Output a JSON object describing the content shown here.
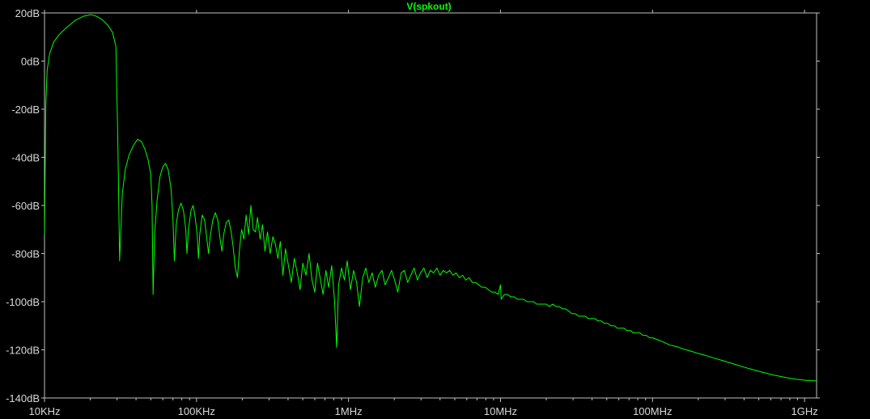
{
  "chart_data": {
    "type": "line",
    "title": "",
    "xlabel": "",
    "ylabel": "",
    "x_scale": "log",
    "xlim": [
      10000,
      1200000000
    ],
    "ylim": [
      -140,
      20
    ],
    "grid": false,
    "background": "#000000",
    "frame_color": "#c0c0c0",
    "x_tick_labels": [
      {
        "value": 10000,
        "label": "10KHz"
      },
      {
        "value": 100000,
        "label": "100KHz"
      },
      {
        "value": 1000000,
        "label": "1MHz"
      },
      {
        "value": 10000000,
        "label": "10MHz"
      },
      {
        "value": 100000000,
        "label": "100MHz"
      },
      {
        "value": 1000000000,
        "label": "1GHz"
      }
    ],
    "y_tick_labels": [
      {
        "value": 20,
        "label": "20dB"
      },
      {
        "value": 0,
        "label": "0dB"
      },
      {
        "value": -20,
        "label": "-20dB"
      },
      {
        "value": -40,
        "label": "-40dB"
      },
      {
        "value": -60,
        "label": "-60dB"
      },
      {
        "value": -80,
        "label": "-80dB"
      },
      {
        "value": -100,
        "label": "-100dB"
      },
      {
        "value": -120,
        "label": "-120dB"
      },
      {
        "value": -140,
        "label": "-140dB"
      }
    ],
    "series": [
      {
        "name": "V(spkout)",
        "color": "#00ff00",
        "x_unit": "Hz",
        "y_unit": "dB",
        "points": [
          [
            10000,
            -72
          ],
          [
            10080,
            -50
          ],
          [
            10200,
            -18
          ],
          [
            10400,
            -4
          ],
          [
            10800,
            3
          ],
          [
            11500,
            8
          ],
          [
            12500,
            11
          ],
          [
            14000,
            14
          ],
          [
            16000,
            17
          ],
          [
            18000,
            18.6
          ],
          [
            20200,
            19.3
          ],
          [
            22000,
            18.6
          ],
          [
            24000,
            17.2
          ],
          [
            26000,
            15
          ],
          [
            28000,
            12
          ],
          [
            29500,
            6
          ],
          [
            30300,
            -30
          ],
          [
            31200,
            -83
          ],
          [
            32500,
            -55
          ],
          [
            34000,
            -45
          ],
          [
            36000,
            -39
          ],
          [
            38500,
            -35
          ],
          [
            41000,
            -32.5
          ],
          [
            43500,
            -33.5
          ],
          [
            46000,
            -37
          ],
          [
            48000,
            -41
          ],
          [
            50000,
            -47
          ],
          [
            51000,
            -60
          ],
          [
            51800,
            -97
          ],
          [
            53000,
            -72
          ],
          [
            55000,
            -58
          ],
          [
            57500,
            -48
          ],
          [
            60000,
            -44
          ],
          [
            62500,
            -42.5
          ],
          [
            65000,
            -45
          ],
          [
            68000,
            -53
          ],
          [
            70000,
            -66
          ],
          [
            71500,
            -83
          ],
          [
            73500,
            -68
          ],
          [
            76000,
            -62
          ],
          [
            79000,
            -59
          ],
          [
            82000,
            -62
          ],
          [
            85000,
            -70
          ],
          [
            86500,
            -80
          ],
          [
            88500,
            -70
          ],
          [
            92000,
            -62
          ],
          [
            95000,
            -60
          ],
          [
            98000,
            -65
          ],
          [
            101000,
            -72
          ],
          [
            103000,
            -82
          ],
          [
            105000,
            -72
          ],
          [
            109000,
            -64
          ],
          [
            113000,
            -66
          ],
          [
            117000,
            -74
          ],
          [
            120000,
            -80
          ],
          [
            123000,
            -73
          ],
          [
            128000,
            -66
          ],
          [
            133000,
            -63
          ],
          [
            138000,
            -66
          ],
          [
            143000,
            -74
          ],
          [
            147000,
            -79
          ],
          [
            151000,
            -72
          ],
          [
            157000,
            -67
          ],
          [
            163000,
            -66
          ],
          [
            169000,
            -71
          ],
          [
            174000,
            -77
          ],
          [
            180000,
            -86
          ],
          [
            186000,
            -90
          ],
          [
            192000,
            -78
          ],
          [
            198000,
            -70
          ],
          [
            205000,
            -74
          ],
          [
            212000,
            -64
          ],
          [
            220000,
            -72
          ],
          [
            228000,
            -60
          ],
          [
            236000,
            -70
          ],
          [
            244000,
            -71
          ],
          [
            252000,
            -65
          ],
          [
            262000,
            -74
          ],
          [
            272000,
            -68
          ],
          [
            282000,
            -79
          ],
          [
            293000,
            -71
          ],
          [
            305000,
            -80
          ],
          [
            318000,
            -73
          ],
          [
            330000,
            -76
          ],
          [
            343000,
            -82
          ],
          [
            356000,
            -75
          ],
          [
            370000,
            -89
          ],
          [
            385000,
            -78
          ],
          [
            400000,
            -84
          ],
          [
            420000,
            -92
          ],
          [
            440000,
            -82
          ],
          [
            460000,
            -88
          ],
          [
            480000,
            -95
          ],
          [
            500000,
            -84
          ],
          [
            525000,
            -89
          ],
          [
            550000,
            -80
          ],
          [
            575000,
            -91
          ],
          [
            600000,
            -96
          ],
          [
            625000,
            -84
          ],
          [
            650000,
            -90
          ],
          [
            680000,
            -97
          ],
          [
            710000,
            -87
          ],
          [
            740000,
            -94
          ],
          [
            775000,
            -85
          ],
          [
            810000,
            -100
          ],
          [
            835000,
            -119
          ],
          [
            860000,
            -93
          ],
          [
            900000,
            -86
          ],
          [
            940000,
            -91
          ],
          [
            980000,
            -83
          ],
          [
            1030000,
            -95
          ],
          [
            1080000,
            -87
          ],
          [
            1130000,
            -92
          ],
          [
            1180000,
            -102
          ],
          [
            1240000,
            -90
          ],
          [
            1300000,
            -86
          ],
          [
            1360000,
            -92
          ],
          [
            1430000,
            -88
          ],
          [
            1500000,
            -94
          ],
          [
            1580000,
            -89
          ],
          [
            1660000,
            -87
          ],
          [
            1740000,
            -93
          ],
          [
            1830000,
            -90
          ],
          [
            1920000,
            -87
          ],
          [
            2010000,
            -91
          ],
          [
            2110000,
            -96
          ],
          [
            2220000,
            -88
          ],
          [
            2330000,
            -87
          ],
          [
            2450000,
            -92
          ],
          [
            2570000,
            -89
          ],
          [
            2700000,
            -86
          ],
          [
            2840000,
            -91
          ],
          [
            2980000,
            -88
          ],
          [
            3130000,
            -86
          ],
          [
            3290000,
            -90
          ],
          [
            3450000,
            -87
          ],
          [
            3630000,
            -88
          ],
          [
            3810000,
            -86
          ],
          [
            4000000,
            -89
          ],
          [
            4200000,
            -87
          ],
          [
            4410000,
            -88
          ],
          [
            4630000,
            -87
          ],
          [
            4860000,
            -89
          ],
          [
            5100000,
            -88
          ],
          [
            5360000,
            -90
          ],
          [
            5630000,
            -89
          ],
          [
            5910000,
            -91
          ],
          [
            6210000,
            -90
          ],
          [
            6520000,
            -92
          ],
          [
            6850000,
            -92
          ],
          [
            7190000,
            -93
          ],
          [
            7550000,
            -94
          ],
          [
            7930000,
            -94
          ],
          [
            8330000,
            -95
          ],
          [
            8740000,
            -96
          ],
          [
            9180000,
            -96
          ],
          [
            9640000,
            -97
          ],
          [
            10000000,
            -93
          ],
          [
            10100000,
            -99
          ],
          [
            10600000,
            -97
          ],
          [
            11100000,
            -97
          ],
          [
            11700000,
            -98
          ],
          [
            12300000,
            -98
          ],
          [
            12900000,
            -99
          ],
          [
            13500000,
            -99
          ],
          [
            14200000,
            -99
          ],
          [
            14900000,
            -100
          ],
          [
            15700000,
            -100
          ],
          [
            16500000,
            -100
          ],
          [
            17300000,
            -101
          ],
          [
            18200000,
            -101
          ],
          [
            19100000,
            -101
          ],
          [
            20000000,
            -101
          ],
          [
            21000000,
            -102
          ],
          [
            22000000,
            -101
          ],
          [
            23200000,
            -102
          ],
          [
            24300000,
            -102
          ],
          [
            25600000,
            -103
          ],
          [
            26800000,
            -103
          ],
          [
            28200000,
            -104
          ],
          [
            29600000,
            -105
          ],
          [
            31100000,
            -105
          ],
          [
            32600000,
            -106
          ],
          [
            34300000,
            -106
          ],
          [
            36000000,
            -106
          ],
          [
            37800000,
            -107
          ],
          [
            39700000,
            -107
          ],
          [
            41700000,
            -107
          ],
          [
            43800000,
            -108
          ],
          [
            46000000,
            -108
          ],
          [
            48300000,
            -109
          ],
          [
            50700000,
            -109
          ],
          [
            53200000,
            -110
          ],
          [
            55900000,
            -110
          ],
          [
            58700000,
            -111
          ],
          [
            61600000,
            -111
          ],
          [
            64700000,
            -111
          ],
          [
            68000000,
            -112
          ],
          [
            71400000,
            -112
          ],
          [
            75000000,
            -113
          ],
          [
            78700000,
            -113
          ],
          [
            82600000,
            -113
          ],
          [
            86800000,
            -114
          ],
          [
            91100000,
            -114
          ],
          [
            95700000,
            -115
          ],
          [
            100000000,
            -115
          ],
          [
            110000000,
            -116
          ],
          [
            120000000,
            -117
          ],
          [
            130000000,
            -118
          ],
          [
            140000000,
            -118.5
          ],
          [
            150000000,
            -119
          ],
          [
            160000000,
            -119.7
          ],
          [
            180000000,
            -120.6
          ],
          [
            200000000,
            -121.5
          ],
          [
            220000000,
            -122.2
          ],
          [
            250000000,
            -123.3
          ],
          [
            280000000,
            -124.2
          ],
          [
            320000000,
            -125.3
          ],
          [
            360000000,
            -126.3
          ],
          [
            400000000,
            -127.2
          ],
          [
            450000000,
            -128.1
          ],
          [
            500000000,
            -128.9
          ],
          [
            560000000,
            -129.7
          ],
          [
            630000000,
            -130.5
          ],
          [
            700000000,
            -131.1
          ],
          [
            800000000,
            -131.8
          ],
          [
            900000000,
            -132.3
          ],
          [
            1000000000,
            -132.6
          ],
          [
            1100000000,
            -132.8
          ],
          [
            1200000000,
            -132.9
          ]
        ]
      }
    ]
  }
}
